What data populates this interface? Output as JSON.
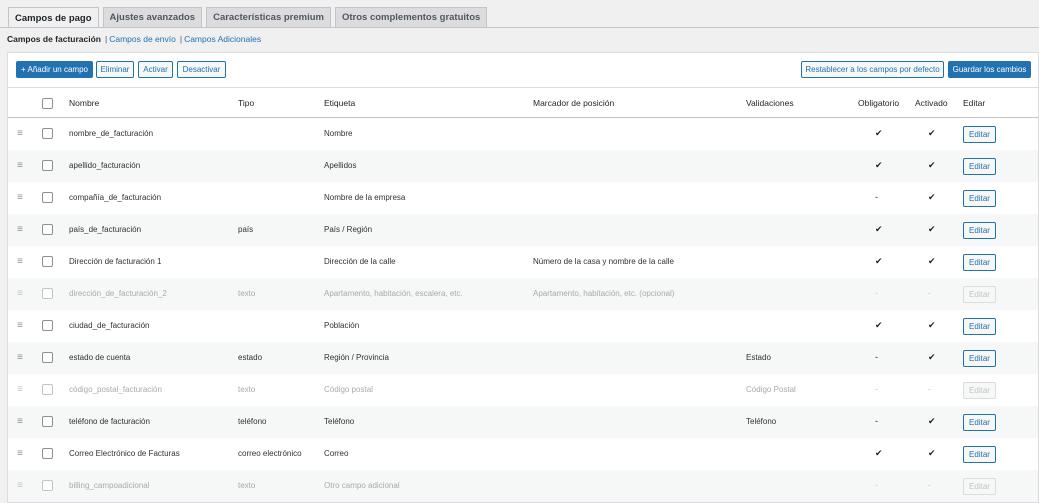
{
  "tabs": [
    {
      "label": "Campos de pago",
      "active": true
    },
    {
      "label": "Ajustes avanzados",
      "active": false
    },
    {
      "label": "Características premium",
      "active": false
    },
    {
      "label": "Otros complementos gratuitos",
      "active": false
    }
  ],
  "subnav": {
    "current": "Campos de facturación",
    "links": [
      "Campos de envío",
      "Campos Adicionales"
    ]
  },
  "toolbar": {
    "add_label": "+ Añadir un campo",
    "delete_label": "Eliminar",
    "activate_label": "Activar",
    "deactivate_label": "Desactivar",
    "reset_label": "Restablecer a los campos por defecto",
    "save_label": "Guardar los cambios"
  },
  "columns": {
    "name": "Nombre",
    "type": "Tipo",
    "label": "Etiqueta",
    "placeholder": "Marcador de posición",
    "validations": "Validaciones",
    "required": "Obligatorio",
    "enabled": "Activado",
    "edit": "Editar"
  },
  "rows": [
    {
      "name": "nombre_de_facturación",
      "type": "",
      "label": "Nombre",
      "placeholder": "",
      "validations": "",
      "required": "✔",
      "enabled": "✔",
      "edit": "Editar",
      "disabled": false
    },
    {
      "name": "apellido_facturación",
      "type": "",
      "label": "Apellidos",
      "placeholder": "",
      "validations": "",
      "required": "✔",
      "enabled": "✔",
      "edit": "Editar",
      "disabled": false
    },
    {
      "name": "compañía_de_facturación",
      "type": "",
      "label": "Nombre de la empresa",
      "placeholder": "",
      "validations": "",
      "required": "-",
      "enabled": "✔",
      "edit": "Editar",
      "disabled": false
    },
    {
      "name": "país_de_facturación",
      "type": "país",
      "label": "País / Región",
      "placeholder": "",
      "validations": "",
      "required": "✔",
      "enabled": "✔",
      "edit": "Editar",
      "disabled": false
    },
    {
      "name": "Dirección de facturación 1",
      "type": "",
      "label": "Dirección de la calle",
      "placeholder": "Número de la casa y nombre de la calle",
      "validations": "",
      "required": "✔",
      "enabled": "✔",
      "edit": "Editar",
      "disabled": false
    },
    {
      "name": "dirección_de_facturación_2",
      "type": "texto",
      "label": "Apartamento, habitación, escalera, etc.",
      "placeholder": "Apartamento, habitación, etc. (opcional)",
      "validations": "",
      "required": "-",
      "enabled": "-",
      "edit": "Editar",
      "disabled": true
    },
    {
      "name": "ciudad_de_facturación",
      "type": "",
      "label": "Población",
      "placeholder": "",
      "validations": "",
      "required": "✔",
      "enabled": "✔",
      "edit": "Editar",
      "disabled": false
    },
    {
      "name": "estado de cuenta",
      "type": "estado",
      "label": "Región / Provincia",
      "placeholder": "",
      "validations": "Estado",
      "required": "-",
      "enabled": "✔",
      "edit": "Editar",
      "disabled": false
    },
    {
      "name": "código_postal_facturación",
      "type": "texto",
      "label": "Código postal",
      "placeholder": "",
      "validations": "Código Postal",
      "required": "-",
      "enabled": "-",
      "edit": "Editar",
      "disabled": true
    },
    {
      "name": "teléfono de facturación",
      "type": "teléfono",
      "label": "Teléfono",
      "placeholder": "",
      "validations": "Teléfono",
      "required": "-",
      "enabled": "✔",
      "edit": "Editar",
      "disabled": false
    },
    {
      "name": "Correo Electrónico de Facturas",
      "type": "correo electrónico",
      "label": "Correo",
      "placeholder": "",
      "validations": "",
      "required": "✔",
      "enabled": "✔",
      "edit": "Editar",
      "disabled": false
    },
    {
      "name": "billing_campoadicional",
      "type": "texto",
      "label": "Otro campo adicional",
      "placeholder": "",
      "validations": "",
      "required": "-",
      "enabled": "-",
      "edit": "Editar",
      "disabled": true
    }
  ]
}
